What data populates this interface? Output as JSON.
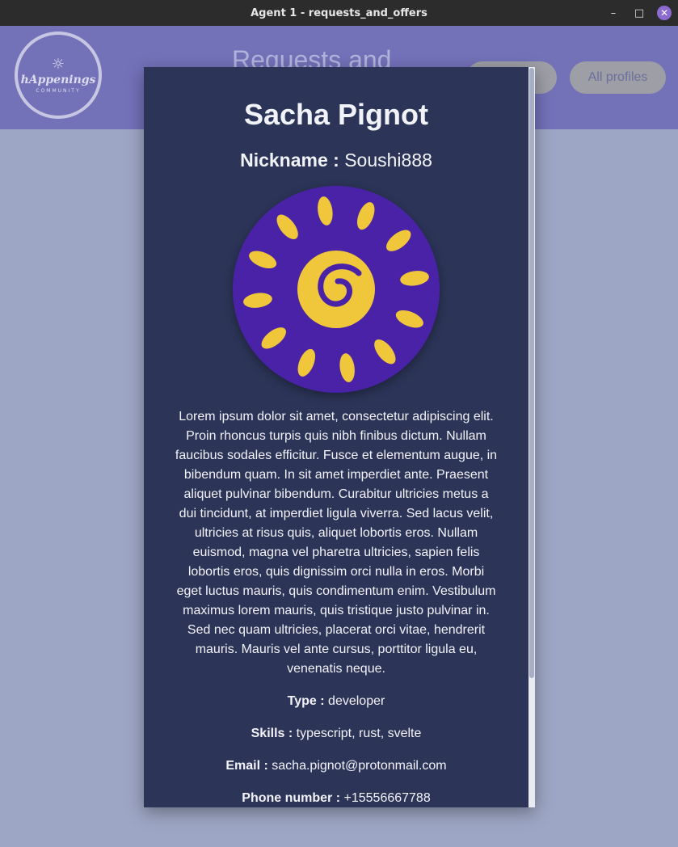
{
  "window": {
    "title": "Agent 1 - requests_and_offers",
    "controls": [
      "minimize",
      "maximize",
      "close"
    ]
  },
  "header": {
    "logo": {
      "brand": "hAppenings",
      "sub": "COMMUNITY"
    },
    "title": "Requests and",
    "nav": [
      {
        "label": "e"
      },
      {
        "label": "All profiles"
      }
    ]
  },
  "profile": {
    "name": "Sacha Pignot",
    "nickname_label": "Nickname :",
    "nickname": "Soushi888",
    "bio": "Lorem ipsum dolor sit amet, consectetur adipiscing elit. Proin rhoncus turpis quis nibh finibus dictum. Nullam faucibus sodales efficitur. Fusce et elementum augue, in bibendum quam. In sit amet imperdiet ante. Praesent aliquet pulvinar bibendum. Curabitur ultricies metus a dui tincidunt, at imperdiet ligula viverra. Sed lacus velit, ultricies at risus quis, aliquet lobortis eros. Nullam euismod, magna vel pharetra ultricies, sapien felis lobortis eros, quis dignissim orci nulla in eros. Morbi eget luctus mauris, quis condimentum enim. Vestibulum maximus lorem mauris, quis tristique justo pulvinar in. Sed nec quam ultricies, placerat orci vitae, hendrerit mauris. Mauris vel ante cursus, porttitor ligula eu, venenatis neque.",
    "fields": [
      {
        "label": "Type :",
        "value": "developer"
      },
      {
        "label": "Skills :",
        "value": "typescript, rust, svelte"
      },
      {
        "label": "Email :",
        "value": "sacha.pignot@protonmail.com"
      },
      {
        "label": "Phone number :",
        "value": "+15556667788"
      }
    ]
  },
  "colors": {
    "modal_bg": "#2c3558",
    "backdrop": "#9da6c4",
    "avatar_bg": "#4a22a8",
    "sun": "#f0c63a"
  }
}
